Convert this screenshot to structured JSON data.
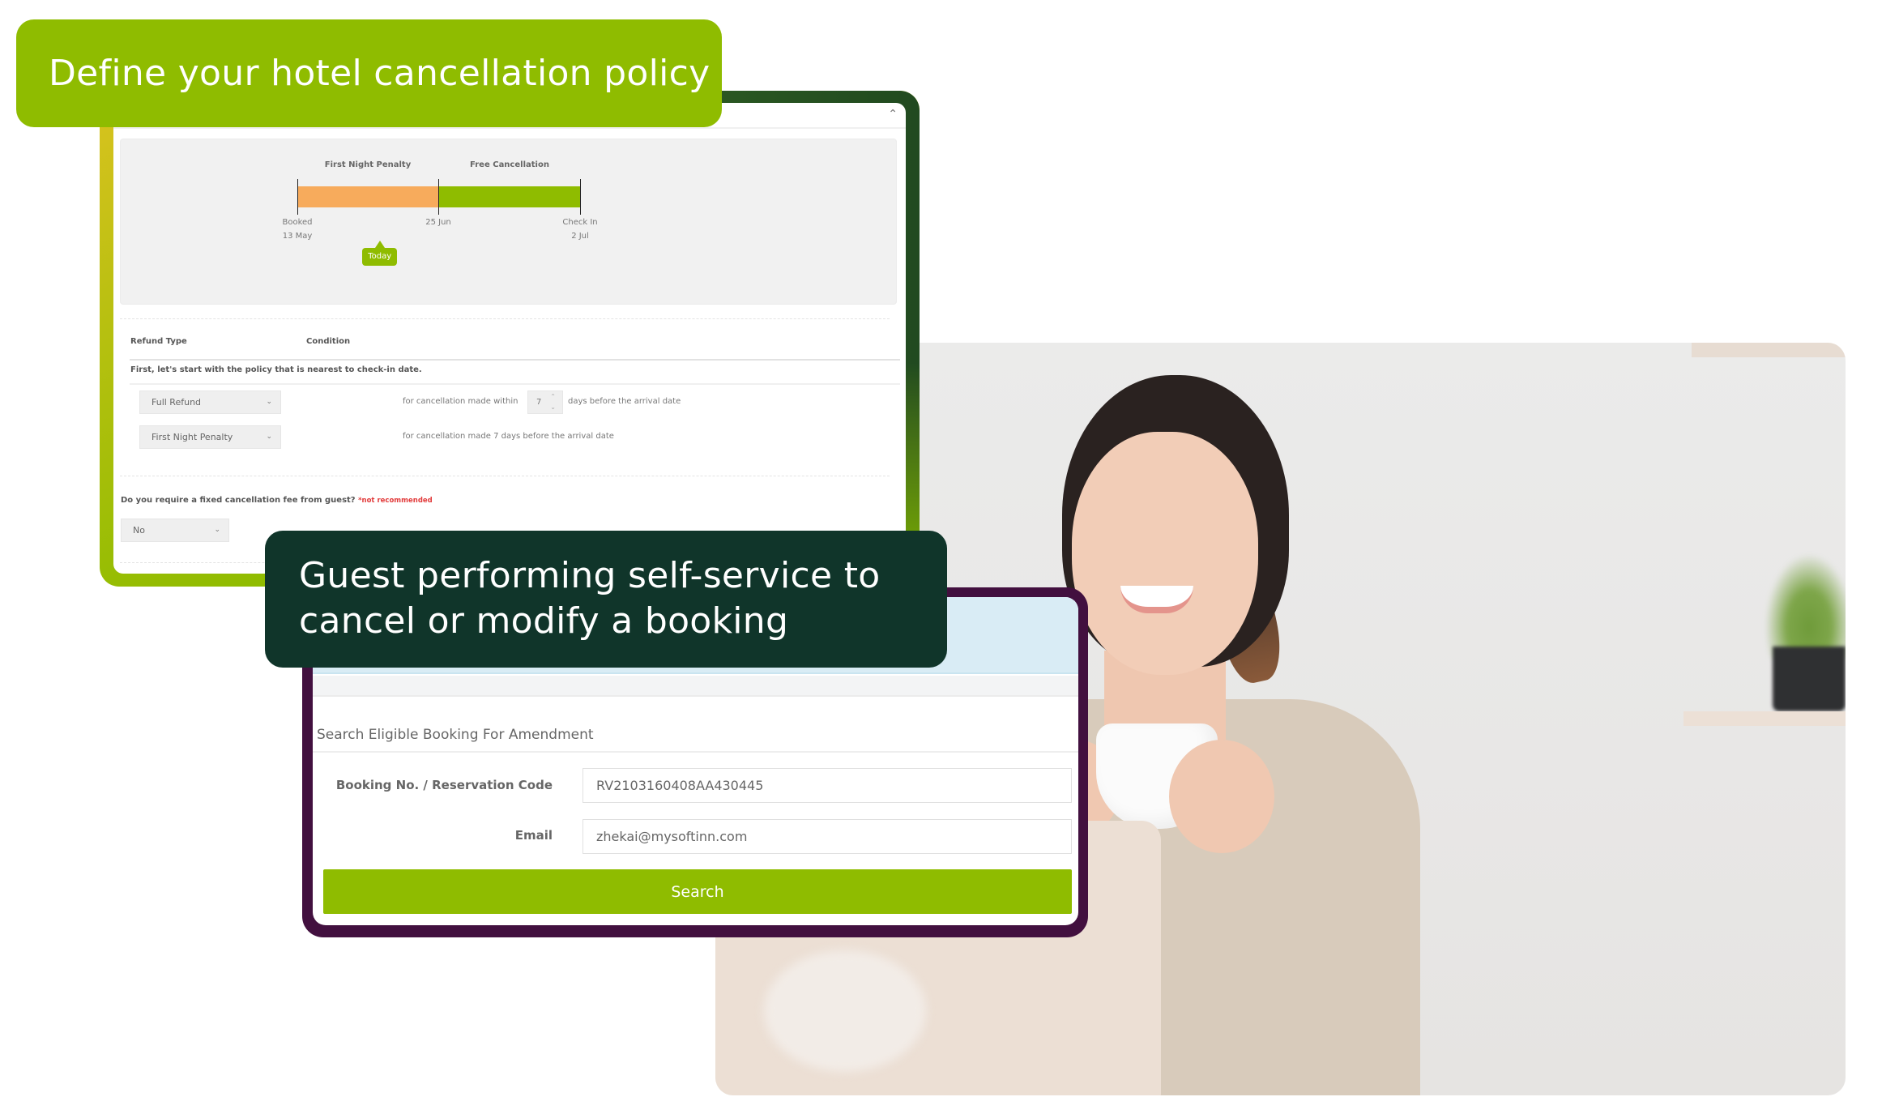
{
  "labels": {
    "policy_title": "Define your hotel cancellation policy",
    "booking_title_line1": "Guest performing self-service to",
    "booking_title_line2": "cancel or modify a booking"
  },
  "colors": {
    "brand_green": "#8fbc00",
    "dark_green": "#10352a",
    "purple_frame": "#42103f",
    "penalty_orange": "#f7ab5c",
    "warning_red": "#e23b3b"
  },
  "policy_panel": {
    "collapse_icon": "chevron-up-icon",
    "timeline": {
      "segments": [
        {
          "label": "First Night Penalty",
          "color": "#f7ab5c",
          "start": "Booked 13 May",
          "end": "25 Jun"
        },
        {
          "label": "Free Cancellation",
          "color": "#8fbc00",
          "start": "25 Jun",
          "end": "Check In 2 Jul"
        }
      ],
      "markers": [
        {
          "line1": "Booked",
          "line2": "13 May"
        },
        {
          "line1": "25 Jun",
          "line2": ""
        },
        {
          "line1": "Check In",
          "line2": "2 Jul"
        }
      ],
      "today_label": "Today",
      "today_position_fraction": 0.29
    },
    "table": {
      "headers": {
        "refund_type": "Refund Type",
        "condition": "Condition"
      },
      "note": "First, let's start with the policy that is nearest to check-in date.",
      "rows": [
        {
          "refund_type": "Full Refund",
          "condition_prefix": "for cancellation made within",
          "days": "7",
          "condition_suffix": "days before the arrival date"
        },
        {
          "refund_type": "First Night Penalty",
          "condition": "for cancellation made 7 days before the arrival date"
        }
      ]
    },
    "fixed_fee": {
      "question": "Do you require a fixed cancellation fee from guest?",
      "warning": "*not recommended",
      "value": "No"
    }
  },
  "booking_panel": {
    "section_title": "Search Eligible Booking For Amendment",
    "fields": {
      "booking_label": "Booking No. / Reservation Code",
      "booking_value": "RV2103160408AA430445",
      "email_label": "Email",
      "email_value": "zhekai@mysoftinn.com"
    },
    "search_label": "Search"
  }
}
